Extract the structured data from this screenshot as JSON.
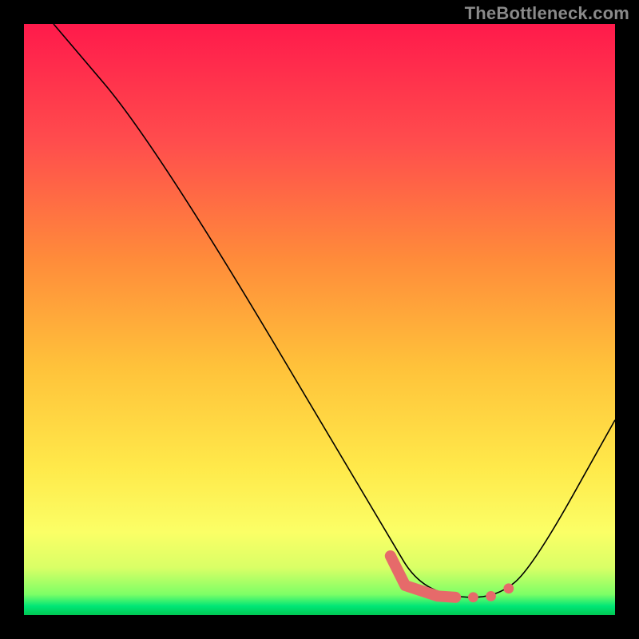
{
  "watermark": "TheBottleneck.com",
  "chart_data": {
    "type": "line",
    "title": "",
    "xlabel": "",
    "ylabel": "",
    "xlim": [
      0,
      100
    ],
    "ylim": [
      0,
      100
    ],
    "background": {
      "type": "vertical_gradient",
      "stops": [
        {
          "pos": 0.0,
          "color": "#ff1a4b"
        },
        {
          "pos": 0.2,
          "color": "#ff4d4d"
        },
        {
          "pos": 0.4,
          "color": "#ff8c3a"
        },
        {
          "pos": 0.58,
          "color": "#ffc23a"
        },
        {
          "pos": 0.75,
          "color": "#ffe94a"
        },
        {
          "pos": 0.86,
          "color": "#fbff66"
        },
        {
          "pos": 0.92,
          "color": "#d9ff66"
        },
        {
          "pos": 0.965,
          "color": "#7dff66"
        },
        {
          "pos": 0.985,
          "color": "#00e676"
        },
        {
          "pos": 1.0,
          "color": "#00c853"
        }
      ]
    },
    "series": [
      {
        "name": "bottleneck-curve",
        "color": "#000000",
        "width": 1.6,
        "points": [
          {
            "x": 5,
            "y": 100
          },
          {
            "x": 22,
            "y": 80
          },
          {
            "x": 62,
            "y": 13
          },
          {
            "x": 66,
            "y": 6
          },
          {
            "x": 72,
            "y": 3
          },
          {
            "x": 80,
            "y": 3
          },
          {
            "x": 86,
            "y": 8
          },
          {
            "x": 100,
            "y": 33
          }
        ]
      }
    ],
    "markers": {
      "name": "highlight-dash",
      "color": "#e66a6a",
      "width": 14,
      "points": [
        {
          "x": 62,
          "y": 10
        },
        {
          "x": 64.5,
          "y": 5
        },
        {
          "x": 70,
          "y": 3.2
        },
        {
          "x": 73,
          "y": 3.0
        }
      ],
      "dots": [
        {
          "x": 76,
          "y": 3.0
        },
        {
          "x": 79,
          "y": 3.2
        },
        {
          "x": 82,
          "y": 4.5
        }
      ]
    }
  }
}
